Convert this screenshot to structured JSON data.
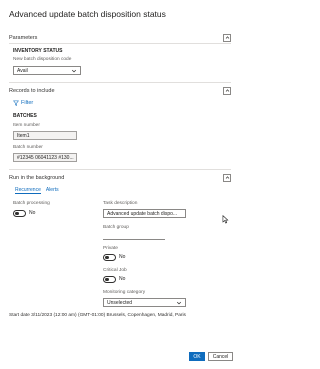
{
  "dialog": {
    "title": "Advanced update batch disposition status"
  },
  "parameters": {
    "header": "Parameters",
    "group": "INVENTORY STATUS",
    "field_label": "New batch disposition code",
    "field_value": "Avail"
  },
  "records": {
    "header": "Records to include",
    "filter_label": "Filter",
    "group": "BATCHES",
    "item_label": "Item number",
    "item_value": "Item1",
    "batch_label": "Batch number",
    "batch_value": "#12345 06041123 #130..."
  },
  "background": {
    "header": "Run in the background",
    "tabs": [
      "Recurrence",
      "Alerts"
    ],
    "batch_processing_label": "Batch processing",
    "batch_processing_value": "No",
    "task_description_label": "Task description",
    "task_description_value": "Advanced update batch dispo...",
    "batch_group_label": "Batch group",
    "batch_group_value": "",
    "private_label": "Private",
    "private_value": "No",
    "critical_job_label": "Critical Job",
    "critical_job_value": "No",
    "monitoring_label": "Monitoring category",
    "monitoring_value": "Unselected"
  },
  "footer": {
    "schedule_text": "Start date 3/11/2023 (12:00 am) (GMT-01:00) Brussels, Copenhagen, Madrid, Paris"
  },
  "actions": {
    "ok": "OK",
    "cancel": "Cancel"
  }
}
